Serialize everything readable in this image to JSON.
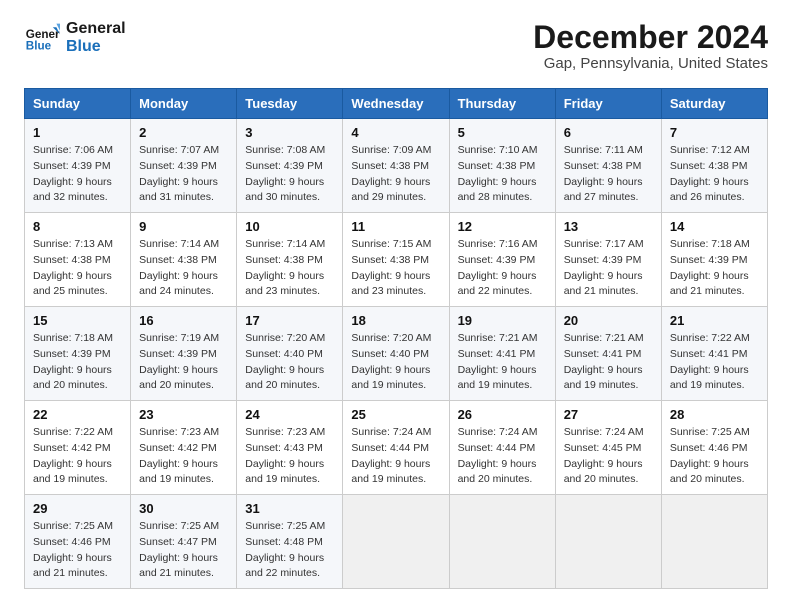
{
  "logo": {
    "line1": "General",
    "line2": "Blue"
  },
  "title": "December 2024",
  "location": "Gap, Pennsylvania, United States",
  "days_of_week": [
    "Sunday",
    "Monday",
    "Tuesday",
    "Wednesday",
    "Thursday",
    "Friday",
    "Saturday"
  ],
  "weeks": [
    [
      {
        "day": 1,
        "sunrise": "7:06 AM",
        "sunset": "4:39 PM",
        "daylight": "9 hours and 32 minutes."
      },
      {
        "day": 2,
        "sunrise": "7:07 AM",
        "sunset": "4:39 PM",
        "daylight": "9 hours and 31 minutes."
      },
      {
        "day": 3,
        "sunrise": "7:08 AM",
        "sunset": "4:39 PM",
        "daylight": "9 hours and 30 minutes."
      },
      {
        "day": 4,
        "sunrise": "7:09 AM",
        "sunset": "4:38 PM",
        "daylight": "9 hours and 29 minutes."
      },
      {
        "day": 5,
        "sunrise": "7:10 AM",
        "sunset": "4:38 PM",
        "daylight": "9 hours and 28 minutes."
      },
      {
        "day": 6,
        "sunrise": "7:11 AM",
        "sunset": "4:38 PM",
        "daylight": "9 hours and 27 minutes."
      },
      {
        "day": 7,
        "sunrise": "7:12 AM",
        "sunset": "4:38 PM",
        "daylight": "9 hours and 26 minutes."
      }
    ],
    [
      {
        "day": 8,
        "sunrise": "7:13 AM",
        "sunset": "4:38 PM",
        "daylight": "9 hours and 25 minutes."
      },
      {
        "day": 9,
        "sunrise": "7:14 AM",
        "sunset": "4:38 PM",
        "daylight": "9 hours and 24 minutes."
      },
      {
        "day": 10,
        "sunrise": "7:14 AM",
        "sunset": "4:38 PM",
        "daylight": "9 hours and 23 minutes."
      },
      {
        "day": 11,
        "sunrise": "7:15 AM",
        "sunset": "4:38 PM",
        "daylight": "9 hours and 23 minutes."
      },
      {
        "day": 12,
        "sunrise": "7:16 AM",
        "sunset": "4:39 PM",
        "daylight": "9 hours and 22 minutes."
      },
      {
        "day": 13,
        "sunrise": "7:17 AM",
        "sunset": "4:39 PM",
        "daylight": "9 hours and 21 minutes."
      },
      {
        "day": 14,
        "sunrise": "7:18 AM",
        "sunset": "4:39 PM",
        "daylight": "9 hours and 21 minutes."
      }
    ],
    [
      {
        "day": 15,
        "sunrise": "7:18 AM",
        "sunset": "4:39 PM",
        "daylight": "9 hours and 20 minutes."
      },
      {
        "day": 16,
        "sunrise": "7:19 AM",
        "sunset": "4:39 PM",
        "daylight": "9 hours and 20 minutes."
      },
      {
        "day": 17,
        "sunrise": "7:20 AM",
        "sunset": "4:40 PM",
        "daylight": "9 hours and 20 minutes."
      },
      {
        "day": 18,
        "sunrise": "7:20 AM",
        "sunset": "4:40 PM",
        "daylight": "9 hours and 19 minutes."
      },
      {
        "day": 19,
        "sunrise": "7:21 AM",
        "sunset": "4:41 PM",
        "daylight": "9 hours and 19 minutes."
      },
      {
        "day": 20,
        "sunrise": "7:21 AM",
        "sunset": "4:41 PM",
        "daylight": "9 hours and 19 minutes."
      },
      {
        "day": 21,
        "sunrise": "7:22 AM",
        "sunset": "4:41 PM",
        "daylight": "9 hours and 19 minutes."
      }
    ],
    [
      {
        "day": 22,
        "sunrise": "7:22 AM",
        "sunset": "4:42 PM",
        "daylight": "9 hours and 19 minutes."
      },
      {
        "day": 23,
        "sunrise": "7:23 AM",
        "sunset": "4:42 PM",
        "daylight": "9 hours and 19 minutes."
      },
      {
        "day": 24,
        "sunrise": "7:23 AM",
        "sunset": "4:43 PM",
        "daylight": "9 hours and 19 minutes."
      },
      {
        "day": 25,
        "sunrise": "7:24 AM",
        "sunset": "4:44 PM",
        "daylight": "9 hours and 19 minutes."
      },
      {
        "day": 26,
        "sunrise": "7:24 AM",
        "sunset": "4:44 PM",
        "daylight": "9 hours and 20 minutes."
      },
      {
        "day": 27,
        "sunrise": "7:24 AM",
        "sunset": "4:45 PM",
        "daylight": "9 hours and 20 minutes."
      },
      {
        "day": 28,
        "sunrise": "7:25 AM",
        "sunset": "4:46 PM",
        "daylight": "9 hours and 20 minutes."
      }
    ],
    [
      {
        "day": 29,
        "sunrise": "7:25 AM",
        "sunset": "4:46 PM",
        "daylight": "9 hours and 21 minutes."
      },
      {
        "day": 30,
        "sunrise": "7:25 AM",
        "sunset": "4:47 PM",
        "daylight": "9 hours and 21 minutes."
      },
      {
        "day": 31,
        "sunrise": "7:25 AM",
        "sunset": "4:48 PM",
        "daylight": "9 hours and 22 minutes."
      },
      null,
      null,
      null,
      null
    ]
  ]
}
